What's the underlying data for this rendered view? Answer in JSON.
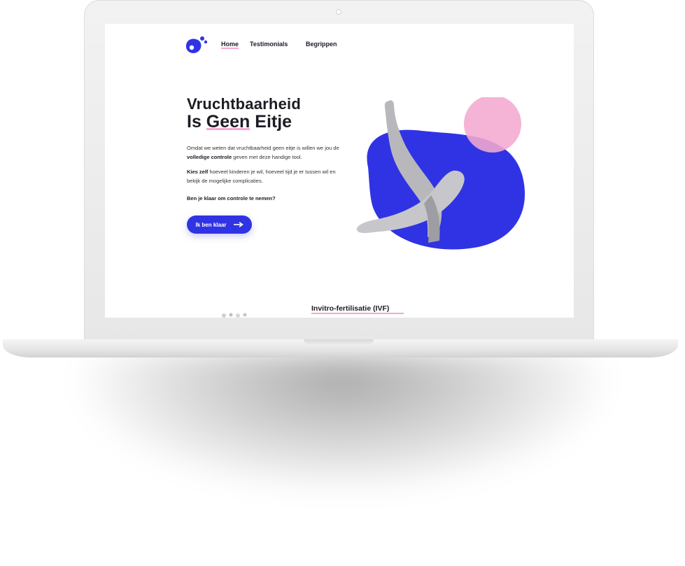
{
  "nav": {
    "items": [
      {
        "label": "Home"
      },
      {
        "label": "Testimonials"
      },
      {
        "label": "Begrippen"
      }
    ]
  },
  "hero": {
    "title_line1": "Vruchtbaarheid",
    "title_line2_part1": "Is ",
    "title_line2_highlight": "Geen",
    "title_line2_part2": " Eitje",
    "p1_text_a": "Omdat we weten dat vruchtbaarheid geen eitje is willen we jou de ",
    "p1_bold": "volledige controle",
    "p1_text_b": " geven met deze handige tool.",
    "p2_bold": "Kies zelf",
    "p2_text": " hoeveel kinderen je wil, hoeveel tijd je er tussen wil en bekijk de mogelijke complicaties.",
    "question": "Ben je klaar om controle te nemen?",
    "cta_label": "Ik ben klaar"
  },
  "section": {
    "heading": "Invitro-fertilisatie (IVF)"
  },
  "colors": {
    "accent_blue": "#3033e3",
    "accent_pink": "#f4a8cf",
    "text_dark": "#1c1c24"
  },
  "icons": {
    "logo": "blob-logo-icon",
    "cta": "arrow-right-icon"
  }
}
